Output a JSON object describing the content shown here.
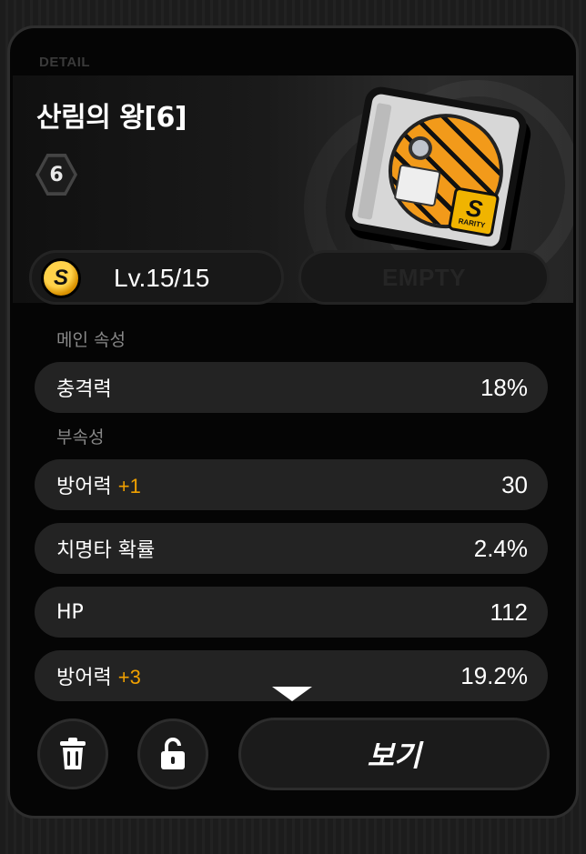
{
  "header": {
    "tag": "DETAIL",
    "title": "산림의 왕[6]",
    "slot_number": "6"
  },
  "disc": {
    "rarity_letter": "S",
    "rarity_label": "RARITY",
    "accent_color": "#f29a1a",
    "rarity_color": "#f0b400"
  },
  "level": {
    "rank_icon": "S",
    "text": "Lv.15/15",
    "empty_label": "EMPTY"
  },
  "main_stats": {
    "label": "메인 속성",
    "items": [
      {
        "name": "충격력",
        "upgrade": "",
        "value": "18%"
      }
    ]
  },
  "sub_stats": {
    "label": "부속성",
    "items": [
      {
        "name": "방어력",
        "upgrade": "+1",
        "value": "30"
      },
      {
        "name": "치명타 확률",
        "upgrade": "",
        "value": "2.4%"
      },
      {
        "name": "HP",
        "upgrade": "",
        "value": "112"
      },
      {
        "name": "방어력",
        "upgrade": "+3",
        "value": "19.2%"
      }
    ]
  },
  "actions": {
    "delete_icon": "trash-icon",
    "lock_icon": "unlock-icon",
    "view_label": "보기"
  },
  "colors": {
    "upgrade": "#f0a000",
    "row_bg": "#232323"
  }
}
